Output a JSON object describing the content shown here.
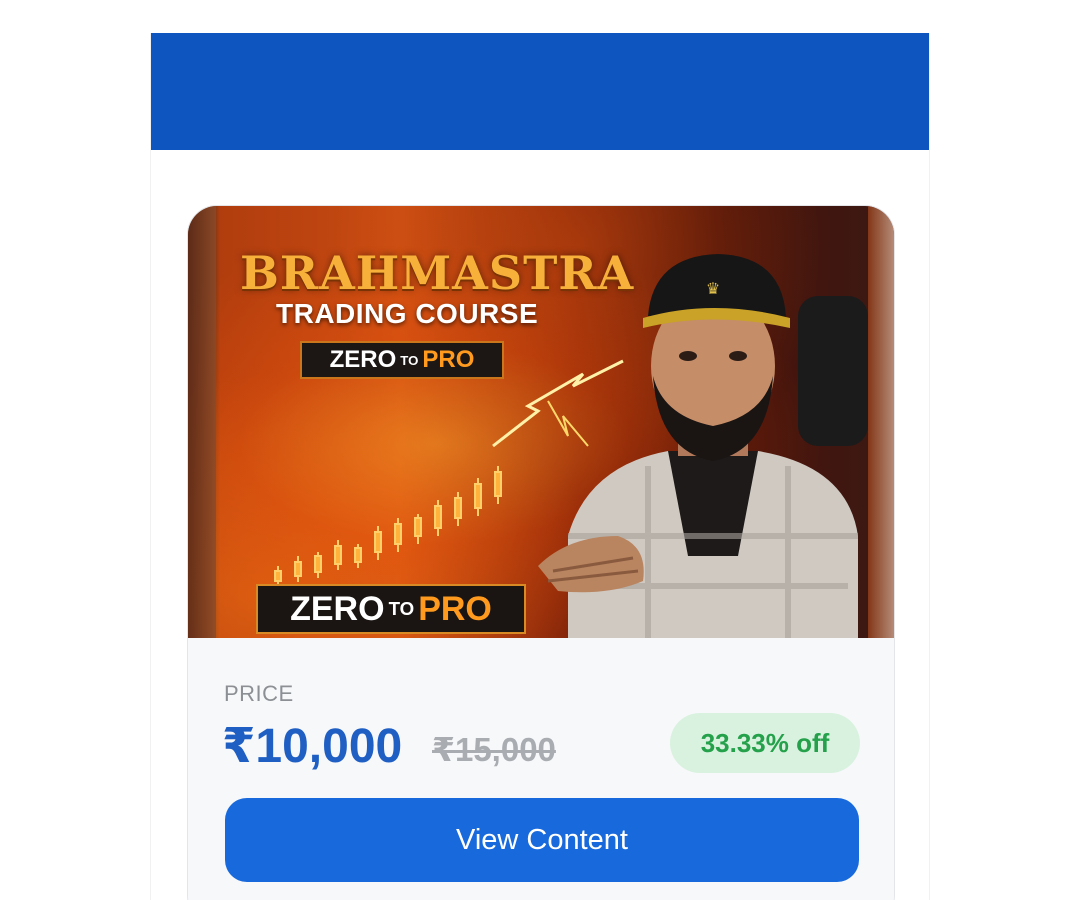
{
  "colors": {
    "topbar": "#0f55bf",
    "price_accent": "#1f5fc4",
    "discount_text": "#24a14a",
    "discount_bg": "#d9f2df",
    "button": "#1769dc"
  },
  "banner": {
    "title": "BRAHMASTRA",
    "subtitle": "TRADING COURSE",
    "tag_zero": "ZERO",
    "tag_to": "TO",
    "tag_pro": "PRO"
  },
  "pricing": {
    "label": "PRICE",
    "current": "₹10,000",
    "original": "₹15,000",
    "discount": "33.33% off"
  },
  "actions": {
    "view_content": "View Content"
  }
}
